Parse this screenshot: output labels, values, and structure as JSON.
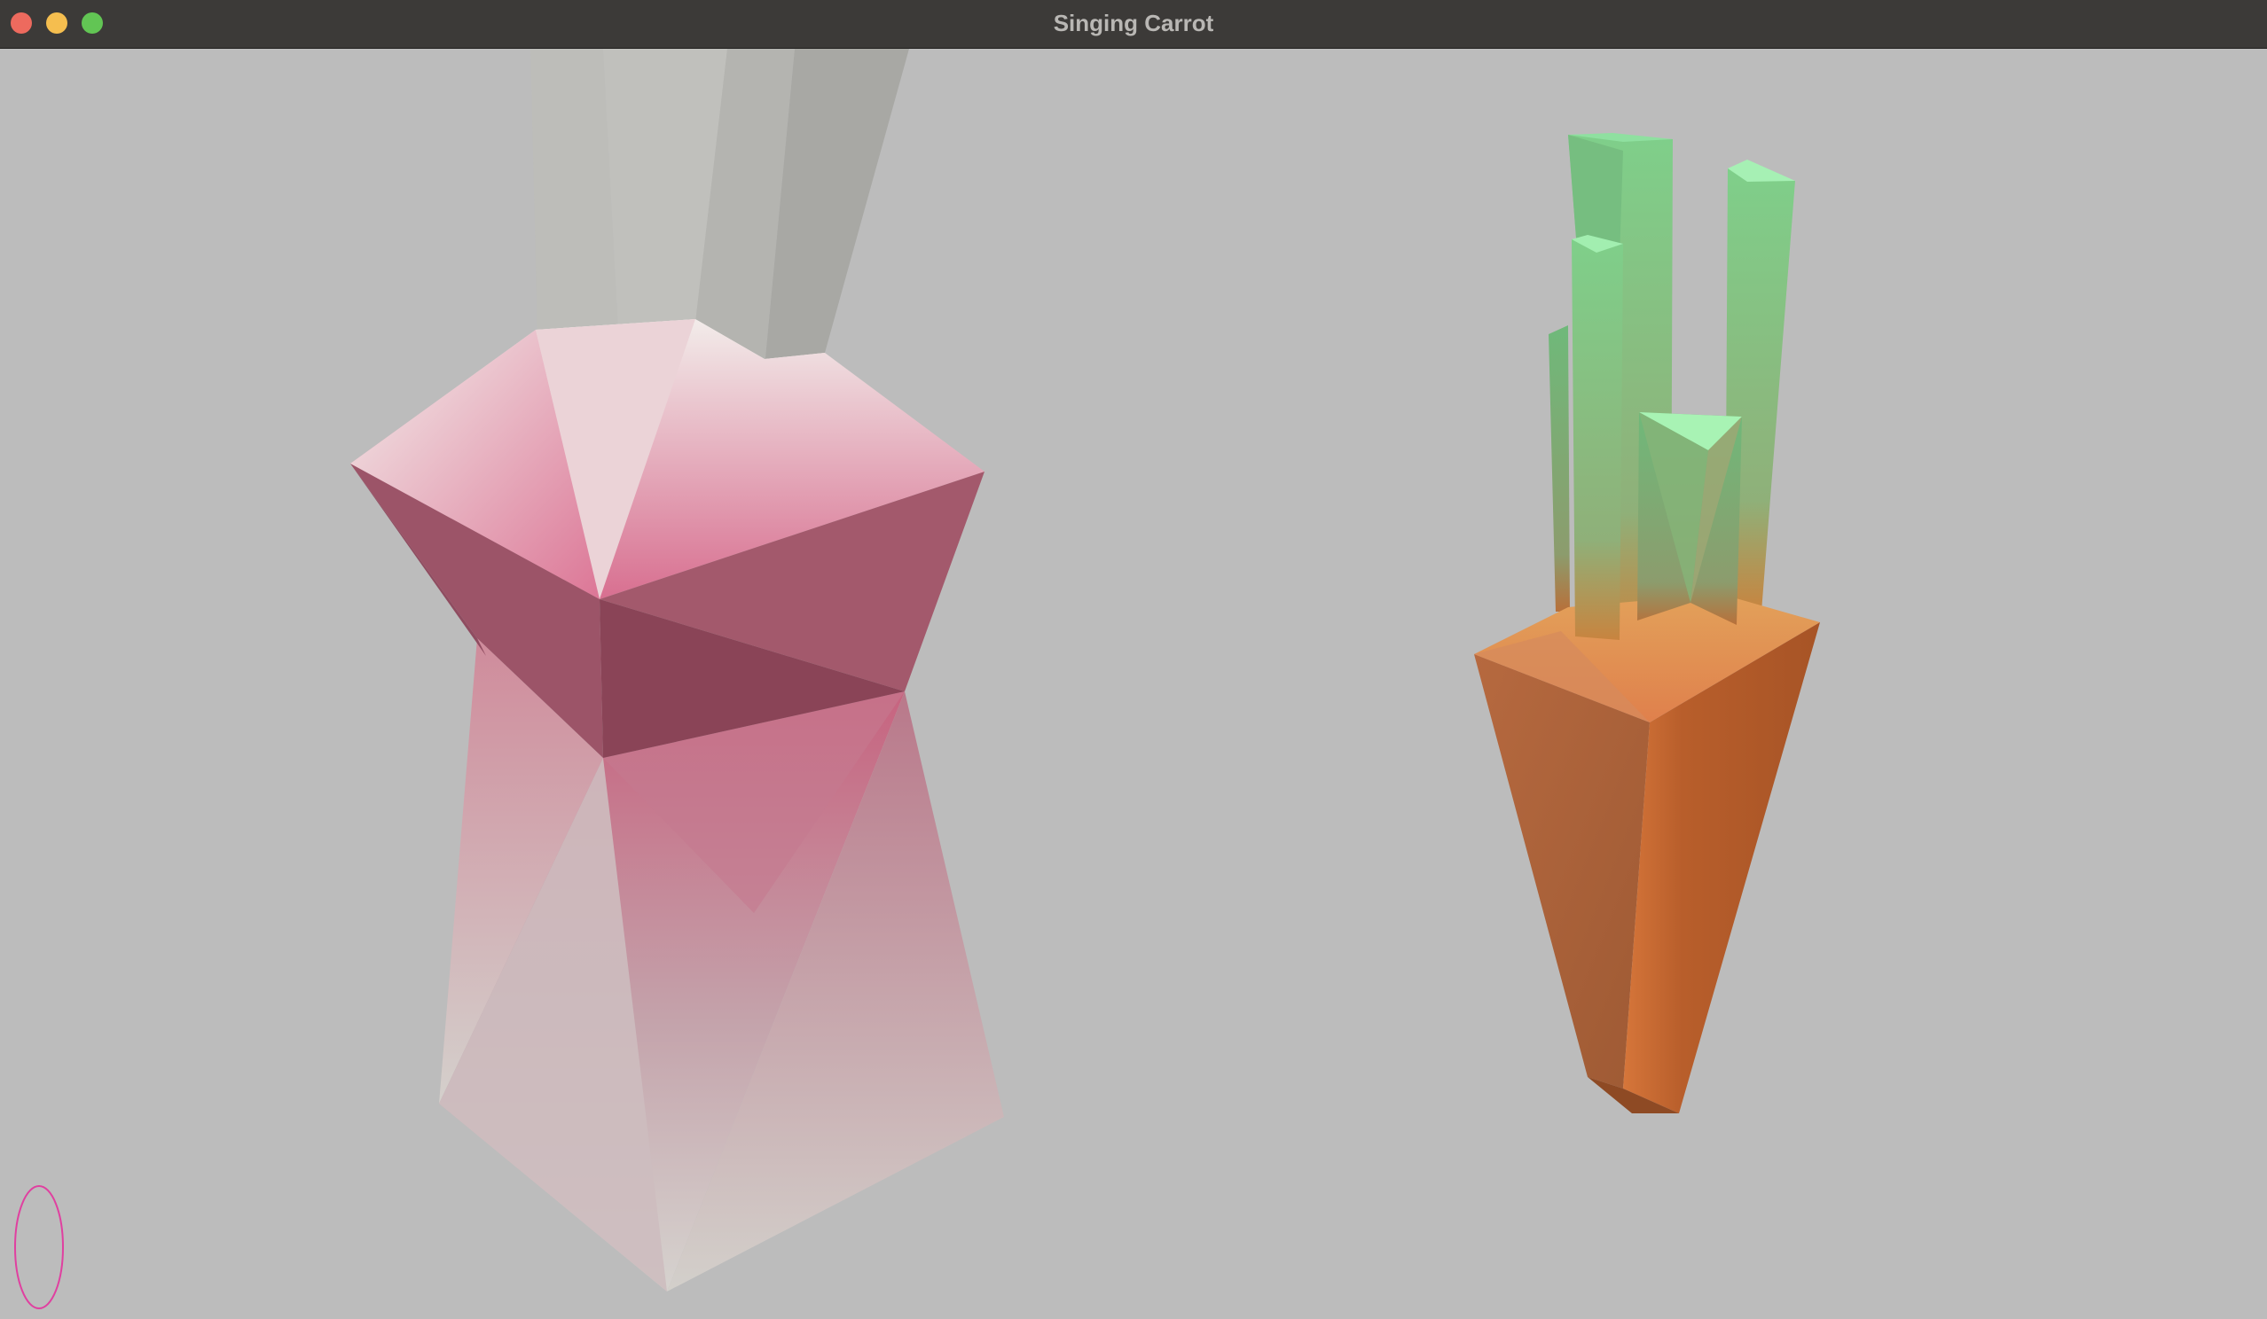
{
  "window": {
    "title": "Singing Carrot",
    "controls": [
      "close",
      "minimize",
      "zoom"
    ]
  },
  "scene": {
    "background": "#bcbcbc",
    "objects": [
      {
        "name": "radish-model",
        "colors": [
          "#c8637f",
          "#9c5468",
          "#e8e4e0"
        ]
      },
      {
        "name": "carrot-model",
        "colors": [
          "#c0612c",
          "#86d890"
        ]
      }
    ],
    "cursor_marker_color": "#e040a0"
  }
}
